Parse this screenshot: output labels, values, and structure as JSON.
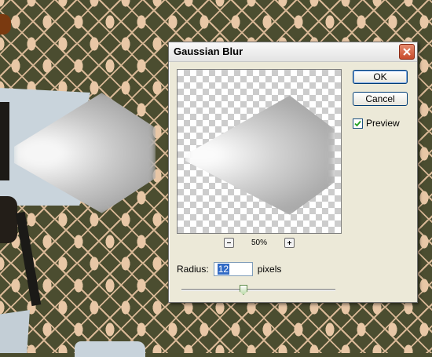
{
  "dialog": {
    "title": "Gaussian Blur",
    "ok_label": "OK",
    "cancel_label": "Cancel",
    "preview_label": "Preview",
    "preview_checked": true,
    "zoom_minus": "−",
    "zoom_level": "50%",
    "zoom_plus": "+",
    "radius_label": "Radius:",
    "radius_value": "12",
    "radius_unit": "pixels",
    "slider_level_fraction": 0.4
  },
  "icons": {
    "close": "close-icon",
    "zoom_out": "zoom-out-icon",
    "zoom_in": "zoom-in-icon",
    "checkmark": "checkmark-icon"
  },
  "colors": {
    "close_button": "#c74b2c",
    "wallpaper_dark": "#4b4d30",
    "wallpaper_light": "#e8c7a6",
    "dialog_bg": "#ece9d8",
    "slider_thumb": "#5c8a49"
  }
}
